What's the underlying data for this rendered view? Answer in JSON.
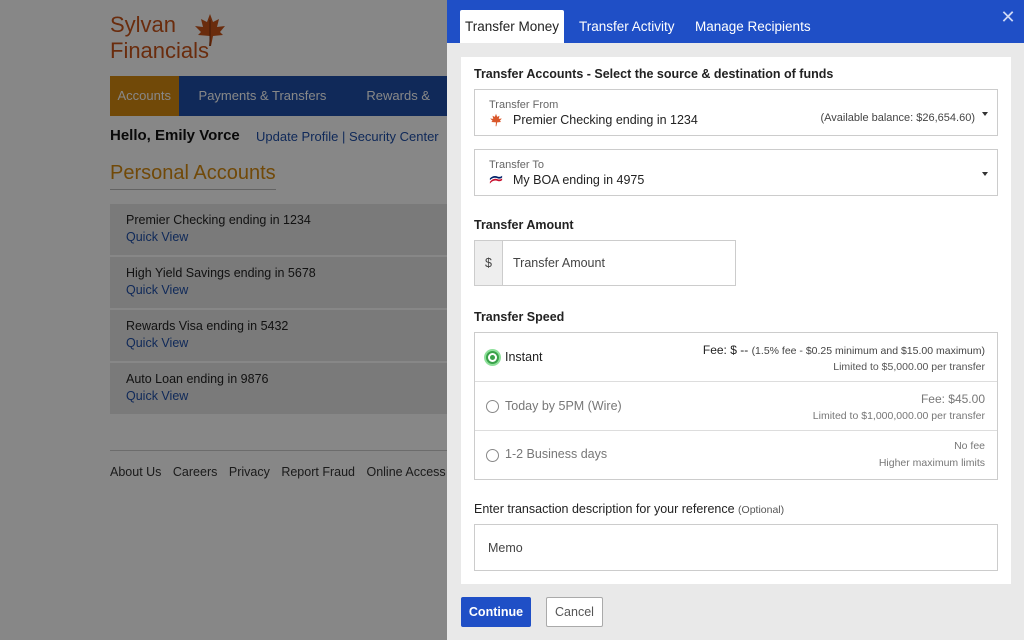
{
  "brand": {
    "line1": "Sylvan",
    "line2": "Financials",
    "color": "#c9541a",
    "icon": "maple-leaf-icon"
  },
  "nav": {
    "items": [
      "Accounts",
      "Payments & Transfers",
      "Rewards &"
    ],
    "active_color": "#d58a10",
    "bar_color": "#1f4fa8"
  },
  "greeting": {
    "text": "Hello, Emily Vorce",
    "update_profile": "Update Profile",
    "separator": "|",
    "security_center": "Security Center"
  },
  "accounts_section": {
    "title": "Personal Accounts",
    "accounts": [
      {
        "name": "Premier Checking ending in 1234",
        "link": "Quick View"
      },
      {
        "name": "High Yield Savings ending in 5678",
        "link": "Quick View"
      },
      {
        "name": "Rewards Visa ending in 5432",
        "link": "Quick View"
      },
      {
        "name": "Auto Loan ending in 9876",
        "link": "Quick View"
      }
    ]
  },
  "footer": {
    "links": [
      "About Us",
      "Careers",
      "Privacy",
      "Report Fraud",
      "Online Access Agree"
    ]
  },
  "drawer": {
    "tabs": [
      "Transfer Money",
      "Transfer Activity",
      "Manage Recipients"
    ],
    "close_icon": "close-icon",
    "accounts_heading": "Transfer Accounts - Select the source & destination of funds",
    "from": {
      "label": "Transfer From",
      "value": "Premier Checking ending in 1234",
      "balance": "(Available balance: $26,654.60)",
      "icon": "maple-leaf-icon"
    },
    "to": {
      "label": "Transfer To",
      "value": "My BOA ending in 4975",
      "icon": "bank-flag-icon"
    },
    "amount_heading": "Transfer Amount",
    "amount_prefix": "$",
    "amount_placeholder": "Transfer Amount",
    "speed_heading": "Transfer Speed",
    "speeds": [
      {
        "label": "Instant",
        "fee": "Fee: $ --",
        "fee_note": "(1.5% fee - $0.25 minimum and $15.00 maximum)",
        "limit": "Limited to $5,000.00 per transfer",
        "selected": true
      },
      {
        "label": "Today by 5PM (Wire)",
        "fee": "Fee: $45.00",
        "fee_note": "",
        "limit": "Limited to $1,000,000.00 per transfer",
        "selected": false
      },
      {
        "label": "1-2 Business days",
        "fee": "No fee",
        "fee_note": "",
        "limit": "Higher maximum limits",
        "selected": false
      }
    ],
    "memo_label": "Enter transaction description for your reference",
    "memo_optional": "(Optional)",
    "memo_placeholder": "Memo",
    "continue_label": "Continue",
    "cancel_label": "Cancel",
    "header_color": "#1f4fc6",
    "selected_color": "#3aa24a"
  }
}
